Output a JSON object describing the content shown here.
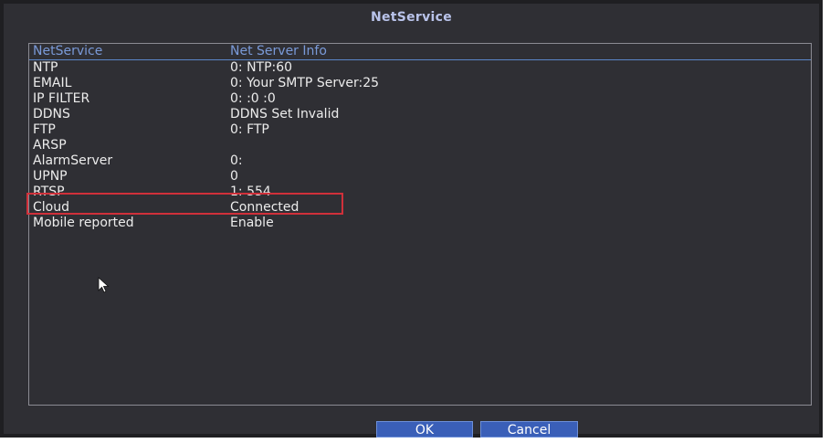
{
  "window": {
    "title": "NetService"
  },
  "table": {
    "headers": [
      "NetService",
      "Net Server Info"
    ],
    "rows": [
      {
        "service": "NTP",
        "info": "0: NTP:60"
      },
      {
        "service": "EMAIL",
        "info": "0: Your SMTP Server:25"
      },
      {
        "service": "IP FILTER",
        "info": "0: :0 :0"
      },
      {
        "service": "DDNS",
        "info": "DDNS Set Invalid"
      },
      {
        "service": "FTP",
        "info": "0: FTP"
      },
      {
        "service": "ARSP",
        "info": ""
      },
      {
        "service": "AlarmServer",
        "info": "0:"
      },
      {
        "service": "UPNP",
        "info": "0"
      },
      {
        "service": "RTSP",
        "info": "1: 554"
      },
      {
        "service": "Cloud",
        "info": "Connected"
      },
      {
        "service": "Mobile reported",
        "info": "Enable"
      }
    ],
    "highlighted_row": "Cloud"
  },
  "buttons": {
    "ok_label": "OK",
    "cancel_label": "Cancel"
  },
  "colors": {
    "background": "#2f2f34",
    "title": "#b9c3ea",
    "header_text": "#7a9ad8",
    "text": "#ececec",
    "button": "#3a5fb8",
    "highlight_border": "#d0303a"
  },
  "icons": {
    "cursor": "mouse-pointer-icon"
  }
}
